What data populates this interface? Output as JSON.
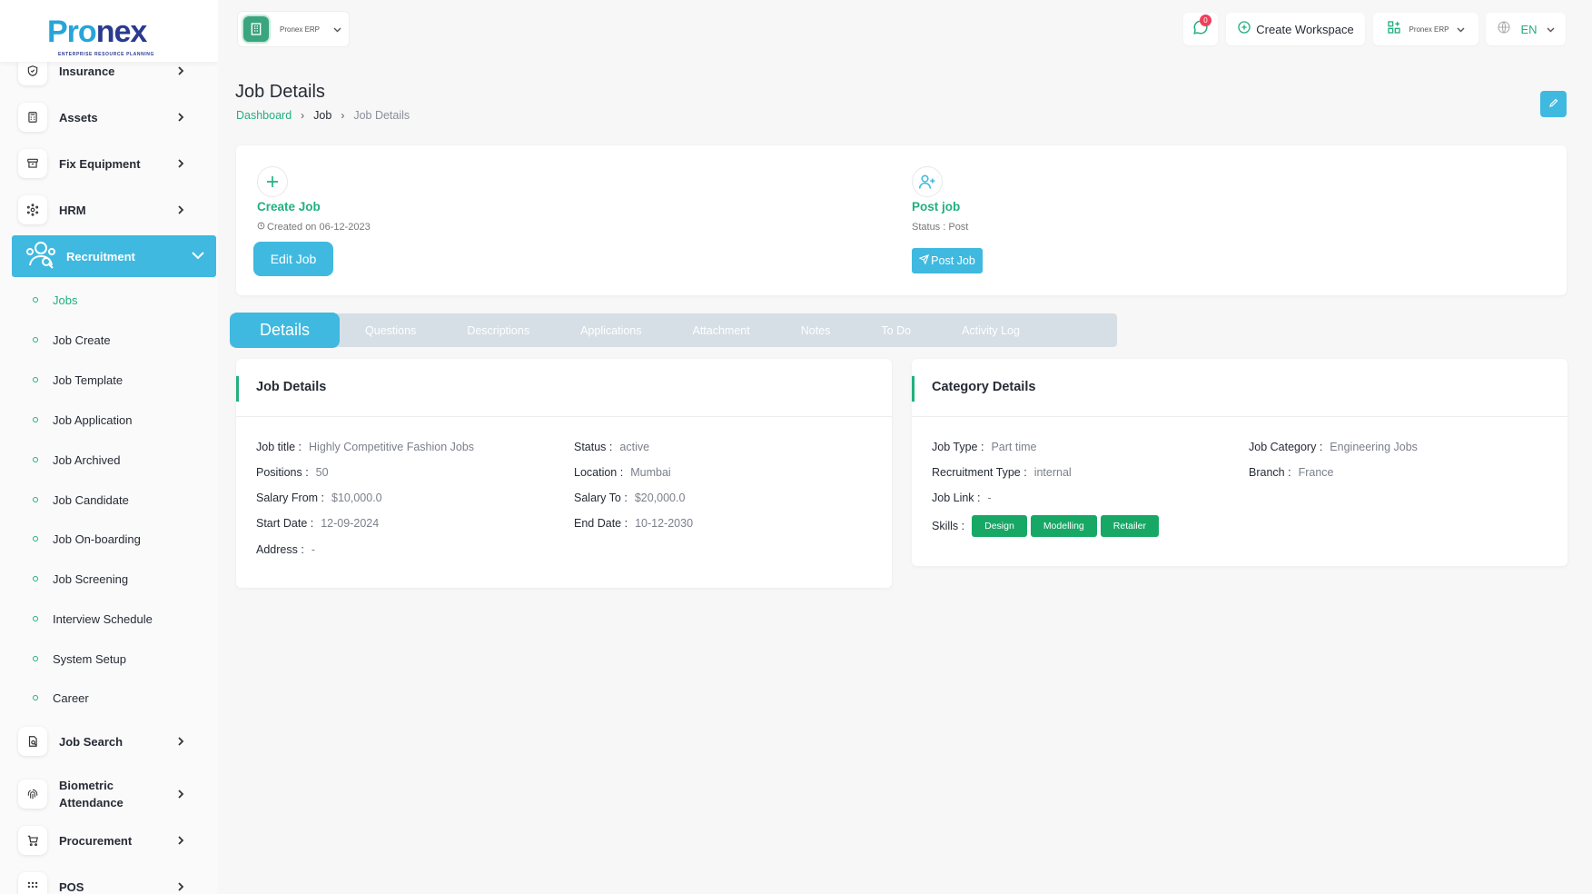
{
  "brand": {
    "logo_part1": "Pro",
    "logo_part2": "nex",
    "tagline": "ENTERPRISE RESOURCE PLANNING"
  },
  "sidebar": {
    "items_top": [
      {
        "label": "Insurance",
        "icon": "shield-icon"
      },
      {
        "label": "Assets",
        "icon": "calculator-icon"
      },
      {
        "label": "Fix Equipment",
        "icon": "archive-icon"
      },
      {
        "label": "HRM",
        "icon": "network-icon"
      }
    ],
    "active": {
      "label": "Recruitment",
      "icon": "recruitment-icon"
    },
    "sub_items": [
      "Jobs",
      "Job Create",
      "Job Template",
      "Job Application",
      "Job Archived",
      "Job Candidate",
      "Job On-boarding",
      "Job Screening",
      "Interview Schedule",
      "System Setup",
      "Career"
    ],
    "items_bottom": [
      {
        "label": "Job Search",
        "icon": "job-search-icon"
      },
      {
        "label": "Biometric Attendance",
        "icon": "fingerprint-icon"
      },
      {
        "label": "Procurement",
        "icon": "cart-icon"
      },
      {
        "label": "POS",
        "icon": "grid-icon"
      }
    ]
  },
  "topbar": {
    "workspace_label": "Pronex ERP",
    "notification_count": "0",
    "create_workspace": "Create Workspace",
    "app_switch_label": "Pronex ERP",
    "language": "EN"
  },
  "page": {
    "title": "Job Details",
    "breadcrumb": [
      "Dashboard",
      "Job",
      "Job Details"
    ]
  },
  "summary": {
    "create_title": "Create Job",
    "created_on": "Created on 06-12-2023",
    "edit_button": "Edit Job",
    "post_title": "Post job",
    "post_status": "Status : Post",
    "post_button": "Post Job"
  },
  "tabs": [
    "Details",
    "Questions",
    "Descriptions",
    "Applications",
    "Attachment",
    "Notes",
    "To Do",
    "Activity Log"
  ],
  "job_details": {
    "title": "Job Details",
    "job_title_k": "Job title :",
    "job_title_v": "Highly Competitive Fashion Jobs",
    "positions_k": "Positions :",
    "positions_v": "50",
    "salary_from_k": "Salary From :",
    "salary_from_v": "$10,000.0",
    "start_date_k": "Start Date :",
    "start_date_v": "12-09-2024",
    "address_k": "Address :",
    "address_v": "-",
    "status_k": "Status :",
    "status_v": "active",
    "location_k": "Location :",
    "location_v": "Mumbai",
    "salary_to_k": "Salary To :",
    "salary_to_v": "$20,000.0",
    "end_date_k": "End Date :",
    "end_date_v": "10-12-2030"
  },
  "category_details": {
    "title": "Category Details",
    "job_type_k": "Job Type :",
    "job_type_v": "Part time",
    "recruitment_type_k": "Recruitment Type :",
    "recruitment_type_v": "internal",
    "job_link_k": "Job Link :",
    "job_link_v": "-",
    "skills_k": "Skills :",
    "skills": [
      "Design",
      "Modelling",
      "Retailer"
    ],
    "job_category_k": "Job Category :",
    "job_category_v": "Engineering Jobs",
    "branch_k": "Branch :",
    "branch_v": "France"
  },
  "colors": {
    "accent": "#3fb9e0",
    "green": "#22b07d",
    "skill_green": "#18a865",
    "badge": "#f03e5a"
  }
}
